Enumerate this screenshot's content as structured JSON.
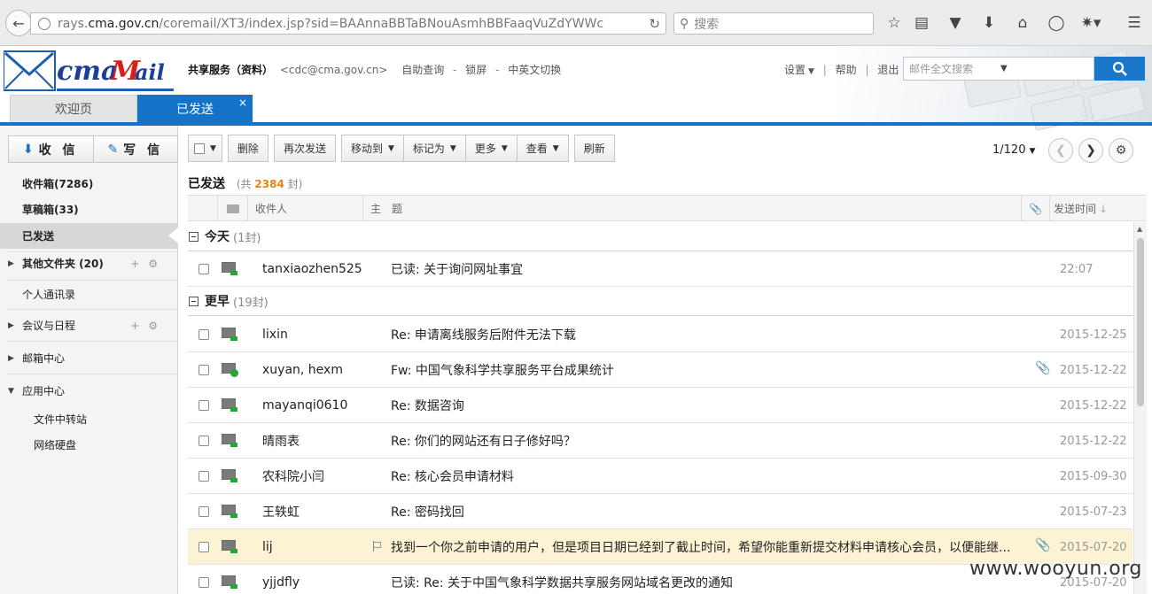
{
  "browser": {
    "url_prefix": "rays.",
    "url_host": "cma.gov.cn",
    "url_path": "/coremail/XT3/index.jsp?sid=BAAnnaBBTaBNouAsmhBBFaaqVuZdYWWc",
    "search_placeholder": "搜索"
  },
  "header": {
    "account_name": "共享服务（资料）",
    "account_email": "<cdc@cma.gov.cn>",
    "links": [
      "自助查询",
      "锁屏",
      "中英文切换"
    ],
    "settings_label": "设置",
    "help_label": "帮助",
    "logout_label": "退出",
    "fulltext_search_placeholder": "邮件全文搜索"
  },
  "tabs": [
    {
      "label": "欢迎页"
    },
    {
      "label": "已发送",
      "active": true,
      "close": "×"
    }
  ],
  "sidebar": {
    "receive_label": "收 信",
    "compose_label": "写 信",
    "inbox": "收件箱(7286)",
    "drafts": "草稿箱(33)",
    "sent": "已发送",
    "other_folders": "其他文件夹 (20)",
    "contacts": "个人通讯录",
    "calendar": "会议与日程",
    "mailbox_center": "邮箱中心",
    "app_center": "应用中心",
    "file_transfer": "文件中转站",
    "netdisk": "网络硬盘"
  },
  "toolbar": {
    "delete": "删除",
    "resend": "再次发送",
    "move_to": "移动到",
    "mark_as": "标记为",
    "more": "更多",
    "view": "查看",
    "refresh": "刷新",
    "pager": "1/120"
  },
  "folder": {
    "title": "已发送",
    "count_prefix": "(共",
    "count": "2384",
    "count_suffix": "封)"
  },
  "columns": {
    "recipient": "收件人",
    "subject": "主　题",
    "sent_time": "发送时间"
  },
  "groups": {
    "today": {
      "label": "今天",
      "count": "(1封)"
    },
    "earlier": {
      "label": "更早",
      "count": "(19封)"
    }
  },
  "mails": [
    {
      "to": "tanxiaozhen525",
      "subject": "已读: 关于询问网址事宜",
      "date": "22:07",
      "attach": false
    },
    {
      "to": "lixin",
      "subject": "Re: 申请离线服务后附件无法下载",
      "date": "2015-12-25",
      "attach": false
    },
    {
      "to": "xuyan, hexm",
      "subject": "Fw: 中国气象科学共享服务平台成果统计",
      "date": "2015-12-22",
      "attach": true
    },
    {
      "to": "mayanqi0610",
      "subject": "Re: 数据咨询",
      "date": "2015-12-22",
      "attach": false
    },
    {
      "to": "晴雨表",
      "subject": "Re: 你们的网站还有日子修好吗？",
      "date": "2015-12-22",
      "attach": false
    },
    {
      "to": "农科院小闫",
      "subject": "Re: 核心会员申请材料",
      "date": "2015-09-30",
      "attach": false
    },
    {
      "to": "王轶虹",
      "subject": "Re: 密码找回",
      "date": "2015-07-23",
      "attach": false
    },
    {
      "to": "lij",
      "subject": "找到一个你之前申请的用户，但是项目日期已经到了截止时间，希望你能重新提交材料申请核心会员，以便能继...",
      "date": "2015-07-20",
      "attach": true
    },
    {
      "to": "yjjdfly",
      "subject": "已读: Re: 关于中国气象科学数据共享服务网站域名更改的通知",
      "date": "2015-07-20",
      "attach": false
    }
  ],
  "watermark": "www.wooyun.org"
}
